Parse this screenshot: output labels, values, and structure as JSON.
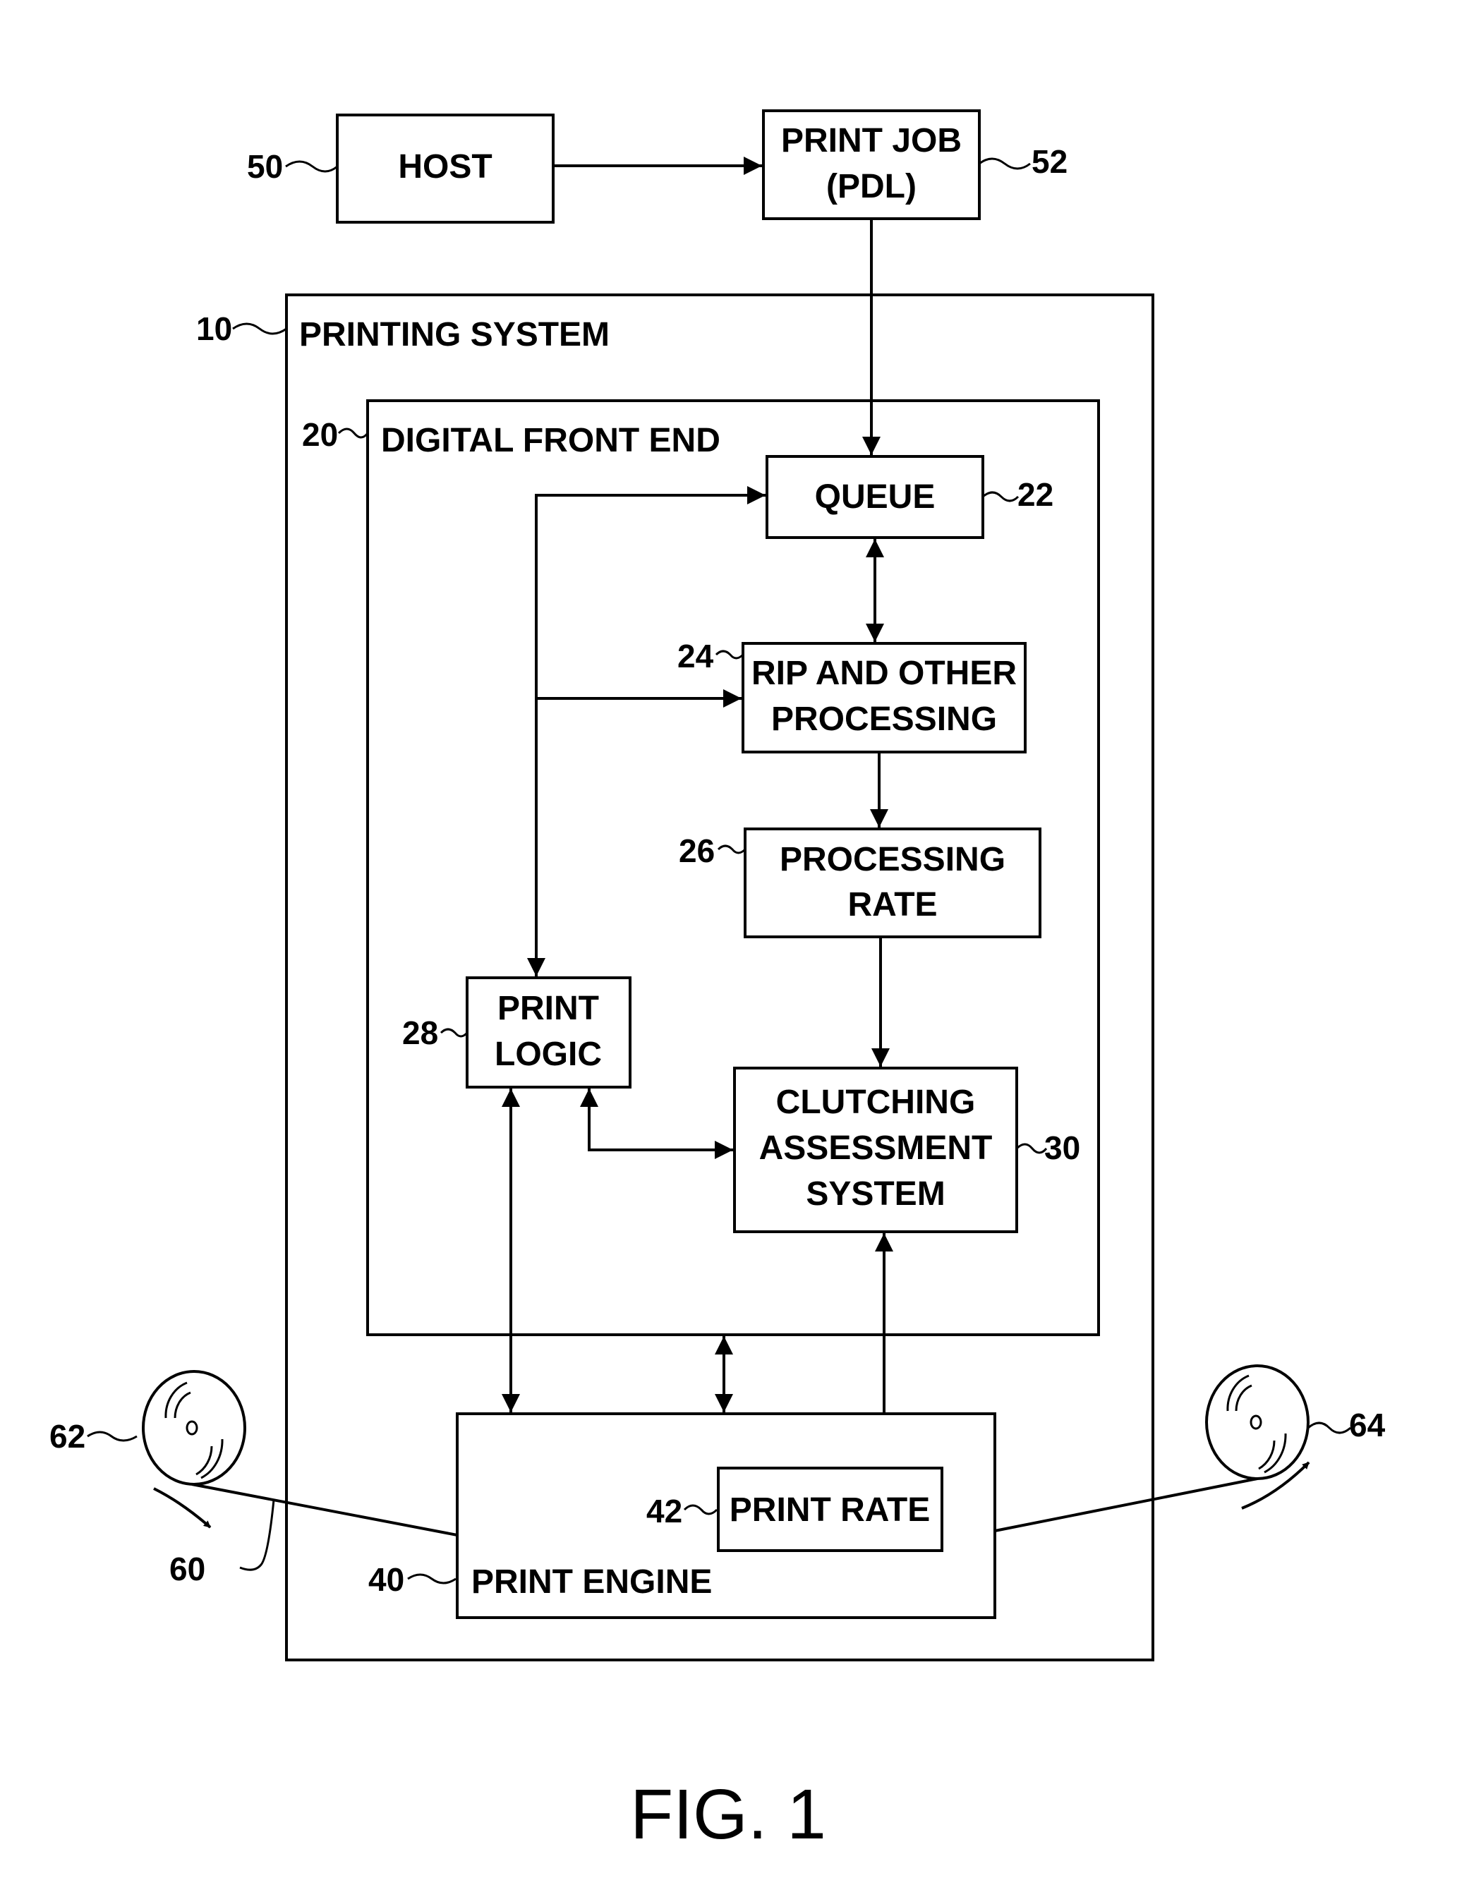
{
  "figure": {
    "caption": "FIG. 1"
  },
  "blocks": {
    "host": {
      "ref": "50",
      "lines": [
        "HOST"
      ]
    },
    "print_job": {
      "ref": "52",
      "lines": [
        "PRINT JOB",
        "(PDL)"
      ]
    },
    "printing_system": {
      "ref": "10",
      "title": "PRINTING SYSTEM"
    },
    "digital_front_end": {
      "ref": "20",
      "title": "DIGITAL FRONT END"
    },
    "queue": {
      "ref": "22",
      "lines": [
        "QUEUE"
      ]
    },
    "rip": {
      "ref": "24",
      "lines": [
        "RIP AND OTHER",
        "PROCESSING"
      ]
    },
    "processing_rate": {
      "ref": "26",
      "lines": [
        "PROCESSING",
        "RATE"
      ]
    },
    "print_logic": {
      "ref": "28",
      "lines": [
        "PRINT",
        "LOGIC"
      ]
    },
    "clutching": {
      "ref": "30",
      "lines": [
        "CLUTCHING",
        "ASSESSMENT",
        "SYSTEM"
      ]
    },
    "print_engine": {
      "ref": "40",
      "title": "PRINT ENGINE"
    },
    "print_rate": {
      "ref": "42",
      "lines": [
        "PRINT RATE"
      ]
    },
    "web": {
      "ref": "60"
    },
    "supply_roll": {
      "ref": "62"
    },
    "takeup_roll": {
      "ref": "64"
    }
  }
}
